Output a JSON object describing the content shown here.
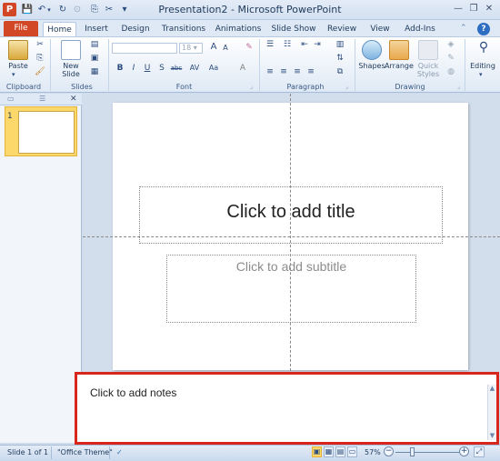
{
  "app": {
    "icon_letter": "P",
    "title": "Presentation2 - Microsoft PowerPoint"
  },
  "qat": {
    "save_icon": "💾",
    "undo_icon": "↶",
    "redo_icon": "↻",
    "customize_icon": "▾"
  },
  "window": {
    "minimize": "—",
    "restore": "❐",
    "close": "✕"
  },
  "tabs": {
    "file": "File",
    "home": "Home",
    "insert": "Insert",
    "design": "Design",
    "transitions": "Transitions",
    "animations": "Animations",
    "slide_show": "Slide Show",
    "review": "Review",
    "view": "View",
    "add_ins": "Add-Ins"
  },
  "ribbon": {
    "paste_label": "Paste",
    "new_slide_label1": "New",
    "new_slide_label2": "Slide",
    "shapes_label": "Shapes",
    "arrange_label": "Arrange",
    "quick_styles_label1": "Quick",
    "quick_styles_label2": "Styles",
    "editing_label": "Editing",
    "groups": {
      "clipboard": "Clipboard",
      "slides": "Slides",
      "font": "Font",
      "paragraph": "Paragraph",
      "drawing": "Drawing"
    },
    "font_buttons": [
      "B",
      "I",
      "U",
      "S",
      "abc",
      "AV",
      "Aa",
      "A"
    ],
    "grow_font": "A",
    "shrink_font": "A"
  },
  "slide_panel": {
    "slide_number": "1"
  },
  "slide": {
    "title_placeholder": "Click to add title",
    "subtitle_placeholder": "Click to add subtitle"
  },
  "notes": {
    "placeholder": "Click to add notes"
  },
  "status": {
    "slide_info": "Slide 1 of 1",
    "theme": "\"Office Theme\"",
    "zoom_level": "57%",
    "zoom_minus": "−",
    "zoom_plus": "+"
  },
  "colors": {
    "file_tab": "#d24726",
    "notes_highlight": "#d9261c",
    "selected_thumb": "#fbd869"
  }
}
